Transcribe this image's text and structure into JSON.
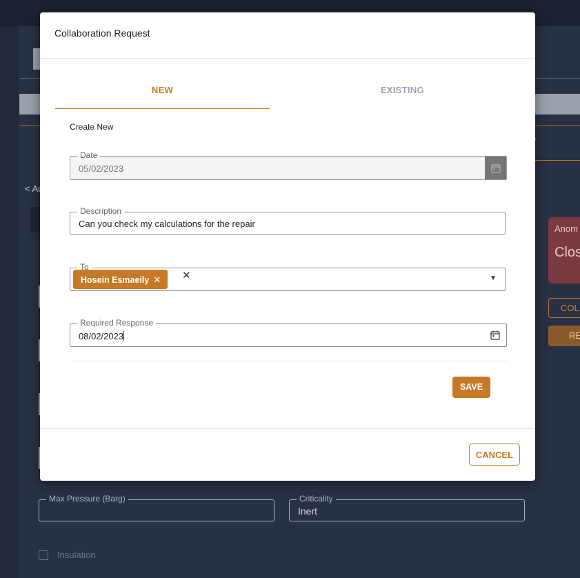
{
  "background": {
    "back_link": "< Ac",
    "anomaly_card": {
      "title": "Anom",
      "value": "Clos"
    },
    "outline_button": "COL",
    "filled_button": "RE",
    "faded_tab_letter": "/",
    "max_pressure_label": "Max Pressure (Barg)",
    "criticality_label": "Criticality",
    "criticality_value": "Inert",
    "insulation_label": "Insulation"
  },
  "modal": {
    "title": "Collaboration Request",
    "tabs": [
      {
        "label": "NEW",
        "active": true
      },
      {
        "label": "EXISTING",
        "active": false
      }
    ],
    "section_title": "Create New",
    "date": {
      "label": "Date",
      "value": "05/02/2023"
    },
    "description": {
      "label": "Description",
      "value": "Can you check my calculations for the repair"
    },
    "to": {
      "label": "To",
      "chip": "Hosein Esmaeily",
      "chip_remove": "✕",
      "clear": "✕",
      "caret": "▼"
    },
    "required_response": {
      "label": "Required Response",
      "value": "08/02/2023"
    },
    "save_label": "SAVE",
    "cancel_label": "CANCEL"
  },
  "colors": {
    "accent": "#c77a26",
    "background": "#222a3a",
    "inactive_tab": "#9aa4b6"
  },
  "icons": [
    "calendar-icon",
    "close-icon",
    "dropdown-caret-icon"
  ]
}
